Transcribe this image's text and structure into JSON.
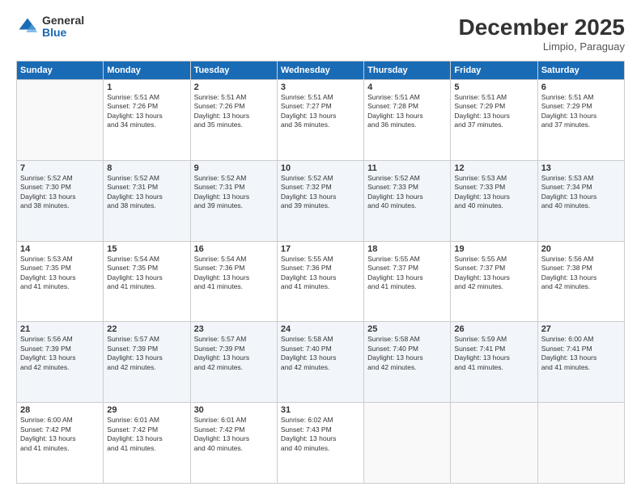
{
  "header": {
    "logo_general": "General",
    "logo_blue": "Blue",
    "month_title": "December 2025",
    "subtitle": "Limpio, Paraguay"
  },
  "days_of_week": [
    "Sunday",
    "Monday",
    "Tuesday",
    "Wednesday",
    "Thursday",
    "Friday",
    "Saturday"
  ],
  "weeks": [
    [
      {
        "day": "",
        "info": ""
      },
      {
        "day": "1",
        "info": "Sunrise: 5:51 AM\nSunset: 7:26 PM\nDaylight: 13 hours\nand 34 minutes."
      },
      {
        "day": "2",
        "info": "Sunrise: 5:51 AM\nSunset: 7:26 PM\nDaylight: 13 hours\nand 35 minutes."
      },
      {
        "day": "3",
        "info": "Sunrise: 5:51 AM\nSunset: 7:27 PM\nDaylight: 13 hours\nand 36 minutes."
      },
      {
        "day": "4",
        "info": "Sunrise: 5:51 AM\nSunset: 7:28 PM\nDaylight: 13 hours\nand 36 minutes."
      },
      {
        "day": "5",
        "info": "Sunrise: 5:51 AM\nSunset: 7:29 PM\nDaylight: 13 hours\nand 37 minutes."
      },
      {
        "day": "6",
        "info": "Sunrise: 5:51 AM\nSunset: 7:29 PM\nDaylight: 13 hours\nand 37 minutes."
      }
    ],
    [
      {
        "day": "7",
        "info": "Sunrise: 5:52 AM\nSunset: 7:30 PM\nDaylight: 13 hours\nand 38 minutes."
      },
      {
        "day": "8",
        "info": "Sunrise: 5:52 AM\nSunset: 7:31 PM\nDaylight: 13 hours\nand 38 minutes."
      },
      {
        "day": "9",
        "info": "Sunrise: 5:52 AM\nSunset: 7:31 PM\nDaylight: 13 hours\nand 39 minutes."
      },
      {
        "day": "10",
        "info": "Sunrise: 5:52 AM\nSunset: 7:32 PM\nDaylight: 13 hours\nand 39 minutes."
      },
      {
        "day": "11",
        "info": "Sunrise: 5:52 AM\nSunset: 7:33 PM\nDaylight: 13 hours\nand 40 minutes."
      },
      {
        "day": "12",
        "info": "Sunrise: 5:53 AM\nSunset: 7:33 PM\nDaylight: 13 hours\nand 40 minutes."
      },
      {
        "day": "13",
        "info": "Sunrise: 5:53 AM\nSunset: 7:34 PM\nDaylight: 13 hours\nand 40 minutes."
      }
    ],
    [
      {
        "day": "14",
        "info": "Sunrise: 5:53 AM\nSunset: 7:35 PM\nDaylight: 13 hours\nand 41 minutes."
      },
      {
        "day": "15",
        "info": "Sunrise: 5:54 AM\nSunset: 7:35 PM\nDaylight: 13 hours\nand 41 minutes."
      },
      {
        "day": "16",
        "info": "Sunrise: 5:54 AM\nSunset: 7:36 PM\nDaylight: 13 hours\nand 41 minutes."
      },
      {
        "day": "17",
        "info": "Sunrise: 5:55 AM\nSunset: 7:36 PM\nDaylight: 13 hours\nand 41 minutes."
      },
      {
        "day": "18",
        "info": "Sunrise: 5:55 AM\nSunset: 7:37 PM\nDaylight: 13 hours\nand 41 minutes."
      },
      {
        "day": "19",
        "info": "Sunrise: 5:55 AM\nSunset: 7:37 PM\nDaylight: 13 hours\nand 42 minutes."
      },
      {
        "day": "20",
        "info": "Sunrise: 5:56 AM\nSunset: 7:38 PM\nDaylight: 13 hours\nand 42 minutes."
      }
    ],
    [
      {
        "day": "21",
        "info": "Sunrise: 5:56 AM\nSunset: 7:39 PM\nDaylight: 13 hours\nand 42 minutes."
      },
      {
        "day": "22",
        "info": "Sunrise: 5:57 AM\nSunset: 7:39 PM\nDaylight: 13 hours\nand 42 minutes."
      },
      {
        "day": "23",
        "info": "Sunrise: 5:57 AM\nSunset: 7:39 PM\nDaylight: 13 hours\nand 42 minutes."
      },
      {
        "day": "24",
        "info": "Sunrise: 5:58 AM\nSunset: 7:40 PM\nDaylight: 13 hours\nand 42 minutes."
      },
      {
        "day": "25",
        "info": "Sunrise: 5:58 AM\nSunset: 7:40 PM\nDaylight: 13 hours\nand 42 minutes."
      },
      {
        "day": "26",
        "info": "Sunrise: 5:59 AM\nSunset: 7:41 PM\nDaylight: 13 hours\nand 41 minutes."
      },
      {
        "day": "27",
        "info": "Sunrise: 6:00 AM\nSunset: 7:41 PM\nDaylight: 13 hours\nand 41 minutes."
      }
    ],
    [
      {
        "day": "28",
        "info": "Sunrise: 6:00 AM\nSunset: 7:42 PM\nDaylight: 13 hours\nand 41 minutes."
      },
      {
        "day": "29",
        "info": "Sunrise: 6:01 AM\nSunset: 7:42 PM\nDaylight: 13 hours\nand 41 minutes."
      },
      {
        "day": "30",
        "info": "Sunrise: 6:01 AM\nSunset: 7:42 PM\nDaylight: 13 hours\nand 40 minutes."
      },
      {
        "day": "31",
        "info": "Sunrise: 6:02 AM\nSunset: 7:43 PM\nDaylight: 13 hours\nand 40 minutes."
      },
      {
        "day": "",
        "info": ""
      },
      {
        "day": "",
        "info": ""
      },
      {
        "day": "",
        "info": ""
      }
    ]
  ]
}
